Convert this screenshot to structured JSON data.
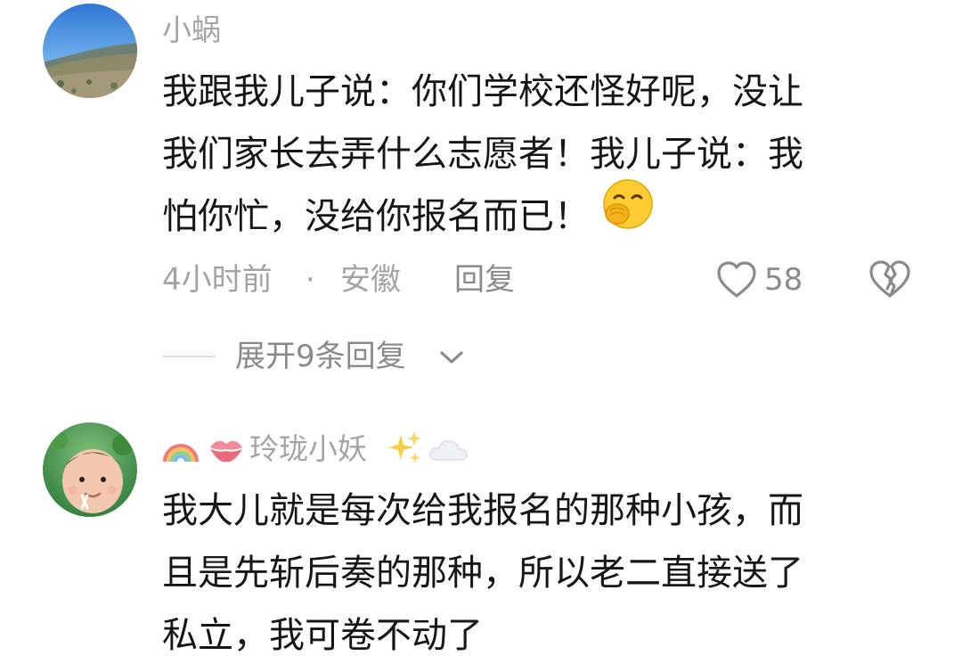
{
  "comments": [
    {
      "username": "小蜗",
      "text_lines": [
        "我跟我儿子说：你们学校还怪好呢，没让",
        "我们家长去弄什么志愿者！我儿子说：我",
        "怕你忙，没给你报名而已！"
      ],
      "inline_emoji": "face-with-hand-over-mouth-emoji",
      "time": "4小时前",
      "separator": "·",
      "location": "安徽",
      "reply_label": "回复",
      "like_count": "58",
      "expand_label": "展开9条回复"
    },
    {
      "username": "玲珑小妖",
      "username_emojis": [
        "rainbow-emoji",
        "kiss-mark-emoji",
        "sparkles-emoji",
        "cloud-emoji"
      ],
      "text_lines": [
        "我大儿就是每次给我报名的那种小孩，而",
        "且是先斩后奏的那种，所以老二直接送了",
        "私立，我可卷不动了"
      ]
    }
  ],
  "colors": {
    "text": "#161616",
    "secondary": "#a3a3a3",
    "action": "#8a8a8a"
  }
}
